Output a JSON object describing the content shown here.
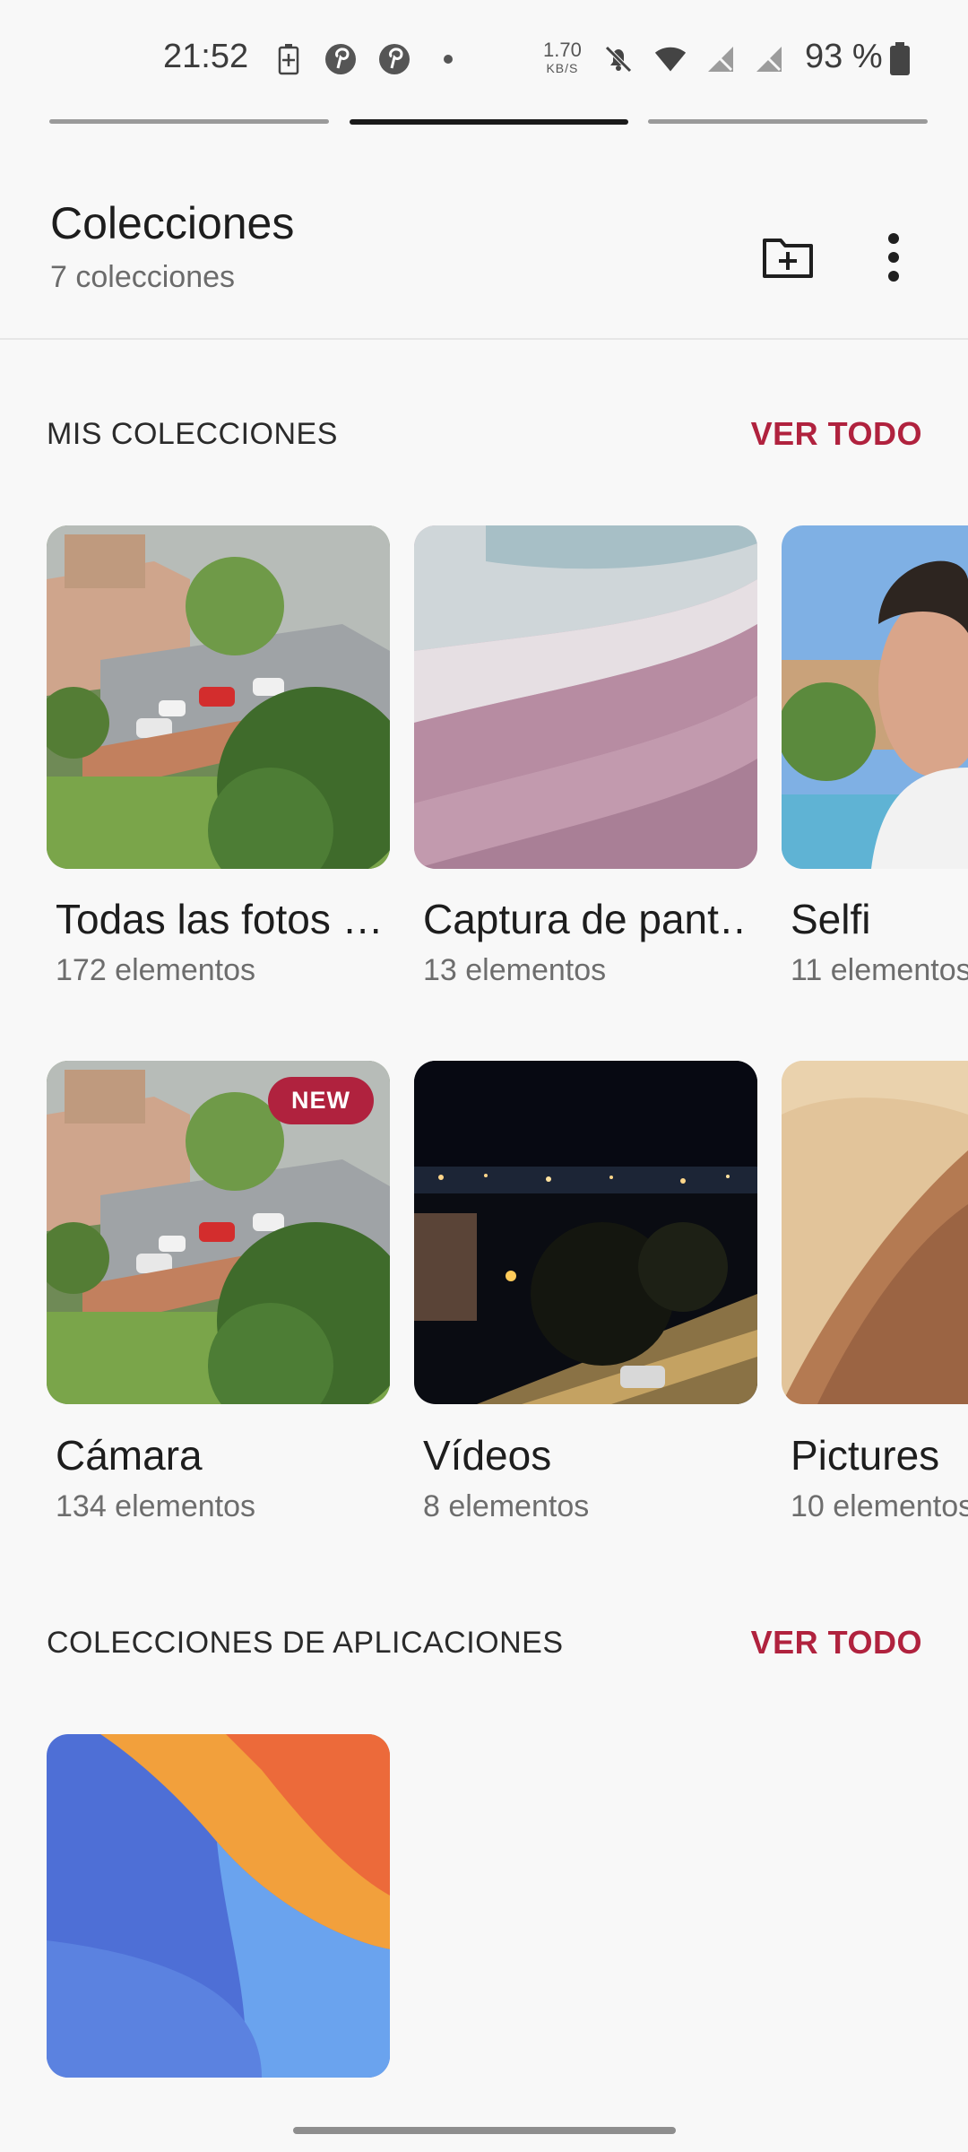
{
  "status_bar": {
    "time": "21:52",
    "speed_value": "1.70",
    "speed_unit": "KB/S",
    "battery": "93 %"
  },
  "header": {
    "title": "Colecciones",
    "subtitle": "7 colecciones"
  },
  "sections": {
    "mine": {
      "label": "MIS COLECCIONES",
      "see_all": "VER TODO"
    },
    "apps": {
      "label": "COLECCIONES DE APLICACIONES",
      "see_all": "VER TODO"
    }
  },
  "collections": [
    {
      "name": "Todas las fotos …",
      "count": "172 elementos"
    },
    {
      "name": "Captura de pant…",
      "count": "13 elementos"
    },
    {
      "name": "Selfi",
      "count": "11 elementos"
    },
    {
      "name": "Cámara",
      "count": "134 elementos",
      "badge": "NEW"
    },
    {
      "name": "Vídeos",
      "count": "8 elementos"
    },
    {
      "name": "Pictures",
      "count": "10 elementos"
    }
  ],
  "colors": {
    "accent": "#b0223e",
    "background": "#f8f8f8"
  }
}
